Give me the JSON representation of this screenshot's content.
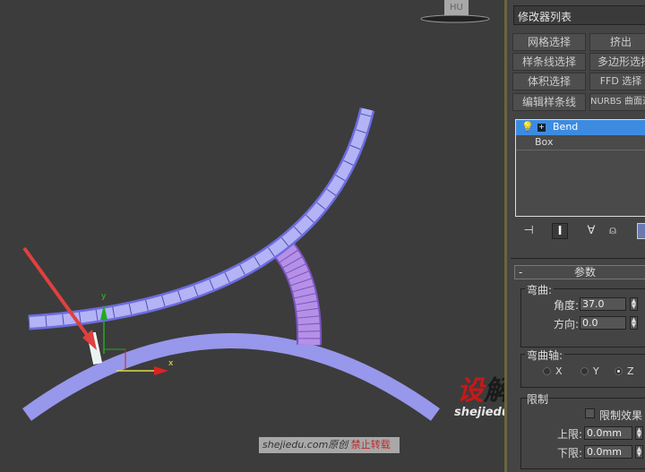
{
  "viewport": {
    "viewcube_label": "HU",
    "gizmo": {
      "y_label": "y",
      "x_label": "x"
    },
    "colors": {
      "object": "#9999ee",
      "selected_segment": "#b08ae0",
      "arrow": "#e04040",
      "y_axis": "#22aa22",
      "x_axis": "#dd2222"
    },
    "watermark": {
      "logo_red": "设",
      "logo_dark": "解读",
      "site": "shejiedu.com"
    },
    "credit": {
      "text": "shejiedu.com原创",
      "notice": "禁止转载"
    }
  },
  "panel": {
    "modifier_list": "修改器列表",
    "buttons": [
      [
        "网格选择",
        "挤出"
      ],
      [
        "样条线选择",
        "多边形选择"
      ],
      [
        "体积选择",
        "FFD 选择"
      ],
      [
        "编辑样条线",
        "NURBS 曲面选择"
      ]
    ],
    "stack": [
      {
        "label": "Bend",
        "selected": true
      },
      {
        "label": "Box",
        "selected": false
      }
    ],
    "toolbar_icons": [
      "pin-stack-icon",
      "show-end-result-icon",
      "make-unique-icon",
      "remove-modifier-icon",
      "configure-sets-icon"
    ],
    "rollout": {
      "toggle": "-",
      "title": "参数"
    },
    "bend": {
      "group_label": "弯曲:",
      "angle_label": "角度:",
      "angle_value": "37.0",
      "direction_label": "方向:",
      "direction_value": "0.0"
    },
    "bend_axis": {
      "group_label": "弯曲轴:",
      "options": [
        "X",
        "Y",
        "Z"
      ],
      "selected": "Z"
    },
    "limits": {
      "group_label": "限制",
      "limit_effect_label": "限制效果",
      "limit_effect_checked": false,
      "upper_label": "上限:",
      "upper_value": "0.0mm",
      "lower_label": "下限:",
      "lower_value": "0.0mm"
    }
  }
}
